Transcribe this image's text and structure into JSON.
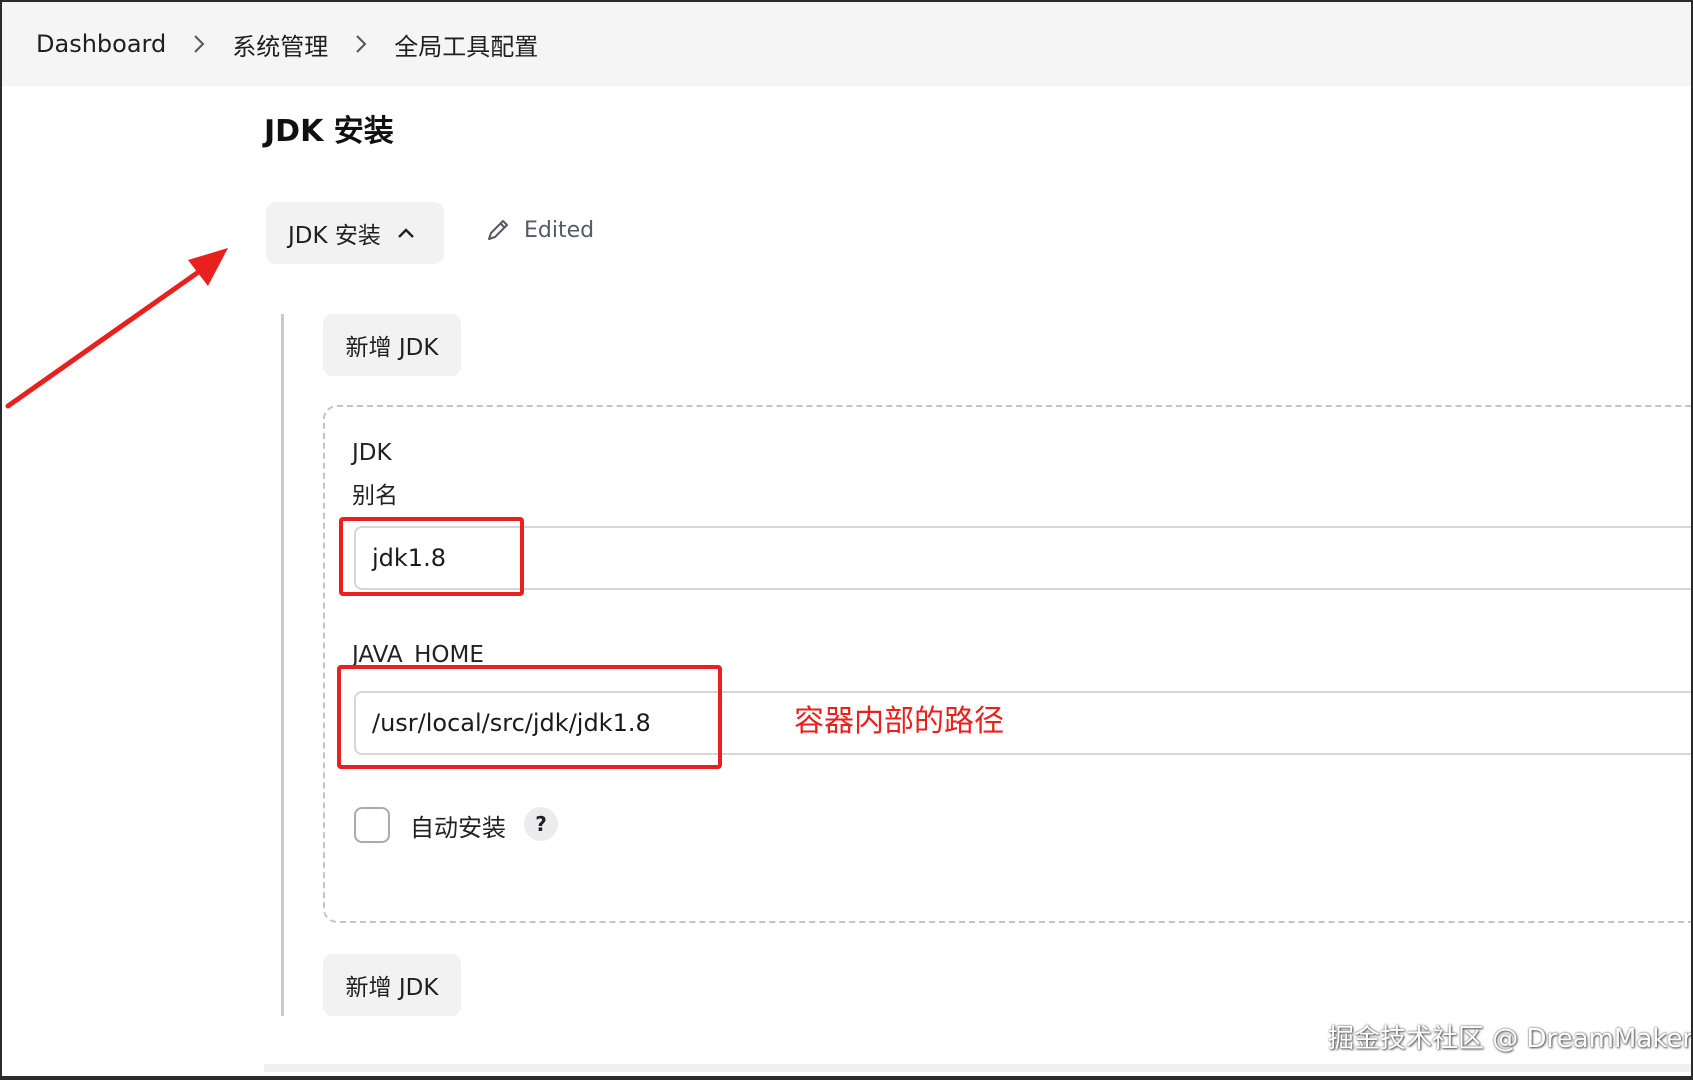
{
  "breadcrumb": {
    "items": [
      "Dashboard",
      "系统管理",
      "全局工具配置"
    ]
  },
  "section": {
    "title": "JDK 安装",
    "toggle_label": "JDK 安装",
    "edited_label": "Edited"
  },
  "jdk_installations": {
    "add_button_label": "新增 JDK",
    "entry": {
      "heading": "JDK",
      "alias_label": "别名",
      "alias_value": "jdk1.8",
      "java_home_label": "JAVA_HOME",
      "java_home_value": "/usr/local/src/jdk/jdk1.8",
      "auto_install_label": "自动安装",
      "auto_install_checked": false,
      "help_symbol": "?"
    }
  },
  "annotation": {
    "note": "容器内部的路径",
    "color": "#e8211f"
  },
  "watermark": "掘金技术社区 @ DreamMaker",
  "icons": {
    "chevron_right": "chevron-right-icon",
    "chevron_up": "chevron-up-icon",
    "pencil": "pencil-icon"
  }
}
